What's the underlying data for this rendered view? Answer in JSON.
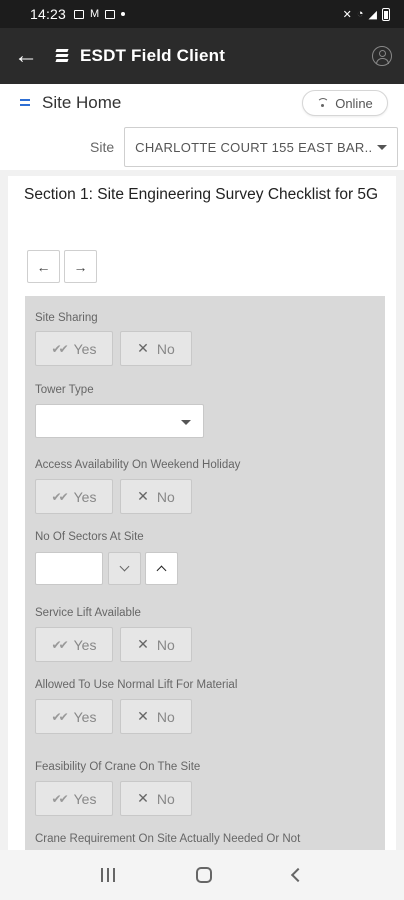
{
  "status_bar": {
    "time": "14:23",
    "icons": [
      "image-icon",
      "gmail-icon",
      "screen-icon",
      "dot-icon",
      "mute-icon",
      "wifi-icon",
      "signal-icon",
      "battery-icon"
    ]
  },
  "app_bar": {
    "title": "ESDT Field Client",
    "back_icon": "arrow-left-icon",
    "account_icon": "account-circle-icon"
  },
  "page_header": {
    "title": "Site Home",
    "online_label": "Online"
  },
  "site": {
    "label": "Site",
    "value": "CHARLOTTE COURT 155 EAST BAR..."
  },
  "section": {
    "title": "Section 1: Site Engineering Survey Checklist for 5G",
    "prev_glyph": "←",
    "next_glyph": "→"
  },
  "fields": {
    "site_sharing": {
      "label": "Site Sharing",
      "yes": "Yes",
      "no": "No"
    },
    "tower_type": {
      "label": "Tower Type",
      "value": ""
    },
    "access_weekend": {
      "label": "Access Availability On Weekend Holiday",
      "yes": "Yes",
      "no": "No"
    },
    "sectors": {
      "label": "No Of Sectors At Site",
      "value": ""
    },
    "service_lift": {
      "label": "Service Lift Available",
      "yes": "Yes",
      "no": "No"
    },
    "normal_lift": {
      "label": "Allowed To Use Normal Lift For Material",
      "yes": "Yes",
      "no": "No"
    },
    "crane_feasibility": {
      "label": "Feasibility Of Crane On The Site",
      "yes": "Yes",
      "no": "No"
    },
    "crane_requirement": {
      "label": "Crane Requirement On Site Actually Needed Or Not"
    }
  },
  "glyphs": {
    "check": "✔✔",
    "cross": "✕"
  }
}
